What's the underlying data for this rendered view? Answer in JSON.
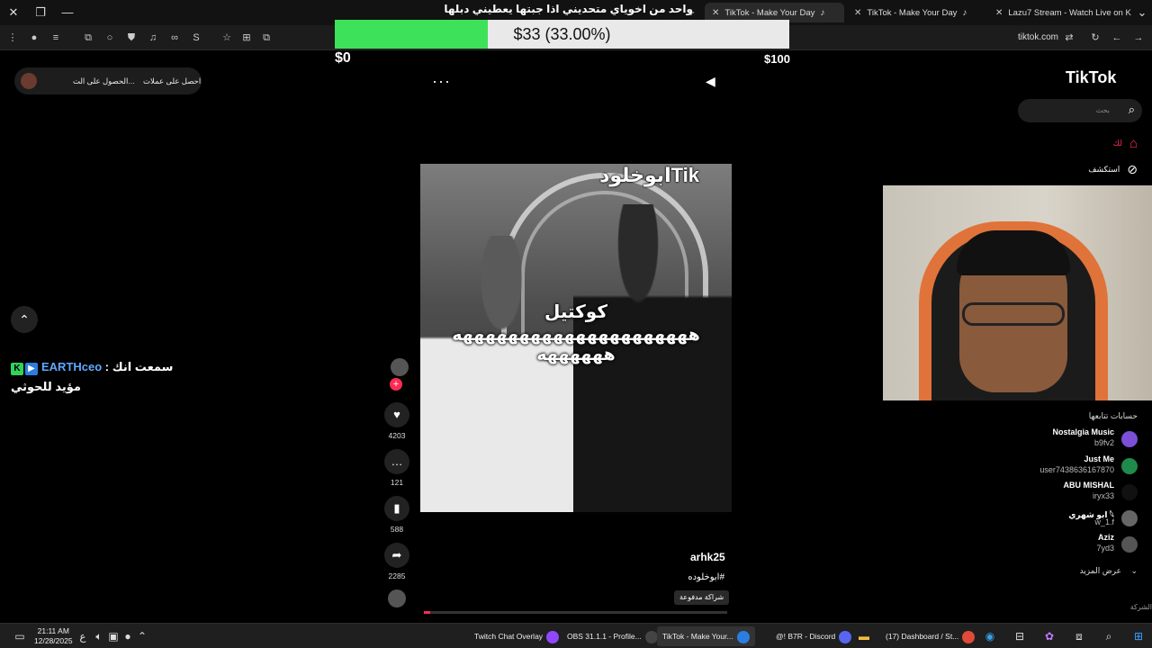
{
  "browser": {
    "tabs": [
      {
        "label": "TikTok - Make Your Day",
        "active": true
      },
      {
        "label": "TikTok - Make Your Day",
        "active": false
      },
      {
        "label": "Lazu7 Stream - Watch Live on K",
        "active": false
      }
    ],
    "url": "tiktok.com"
  },
  "overlay": {
    "title": "واحد من اخوياي متحديني اذا جبتها يعطيني دبلها",
    "goal_text": "$33 (33.00%)",
    "goal_fraction": 0.33,
    "goal_min": "$0",
    "goal_max": "$100",
    "fill_color": "#3ee25a"
  },
  "tiktok": {
    "logo": "TikTok",
    "search_placeholder": "بحث",
    "nav": {
      "home": "لك",
      "explore": "استكشف"
    },
    "get_coins": "احصل على عملات",
    "get_app": "الحصول على الت...",
    "video": {
      "top_caption": "ابوخلودTik",
      "caption1": "كوكتيل",
      "caption2": "هههههههههههههههههههههه ههههههه",
      "username": "arhk25",
      "hashtag": "#ابوخلوده",
      "paid_label": "شراكة مدفوعة",
      "progress_fraction": 0.02,
      "likes": "4203",
      "comments": "121",
      "saves": "588",
      "shares": "2285"
    },
    "following_header": "حسابات تتابعها",
    "following": [
      {
        "name": "Nostalgia Music",
        "handle": "b9fv2",
        "color": "#7b4fd6"
      },
      {
        "name": "Just Me",
        "handle": "user7438636167870",
        "color": "#1f8a4c"
      },
      {
        "name": "ABU MISHAL",
        "handle": "iryx33",
        "color": "#111111"
      },
      {
        "name": "ابو شهري 𓆩",
        "handle": "w_1.f",
        "color": "#666666"
      },
      {
        "name": "Aziz",
        "handle": "7yd3",
        "color": "#555555"
      }
    ],
    "see_more": "عرض المزيد",
    "company": "الشركة"
  },
  "chat": {
    "user": "EARTHceo",
    "message": "سمعت انك",
    "line2": "مؤيد للحوثي"
  },
  "taskbar": {
    "time": "21:11 AM",
    "date": "12/28/2025",
    "lang": "ع",
    "tasks": [
      {
        "label": "Twitch Chat Overlay",
        "color": "#9146ff"
      },
      {
        "label": "OBS 31.1.1 - Profile...",
        "color": "#444"
      },
      {
        "label": "TikTok - Make Your...",
        "color": "#2b7de0"
      },
      {
        "label": "@! B7R - Discord",
        "color": "#5865f2"
      },
      {
        "label": "(17) Dashboard / St...",
        "color": "#e04a3a"
      }
    ]
  }
}
